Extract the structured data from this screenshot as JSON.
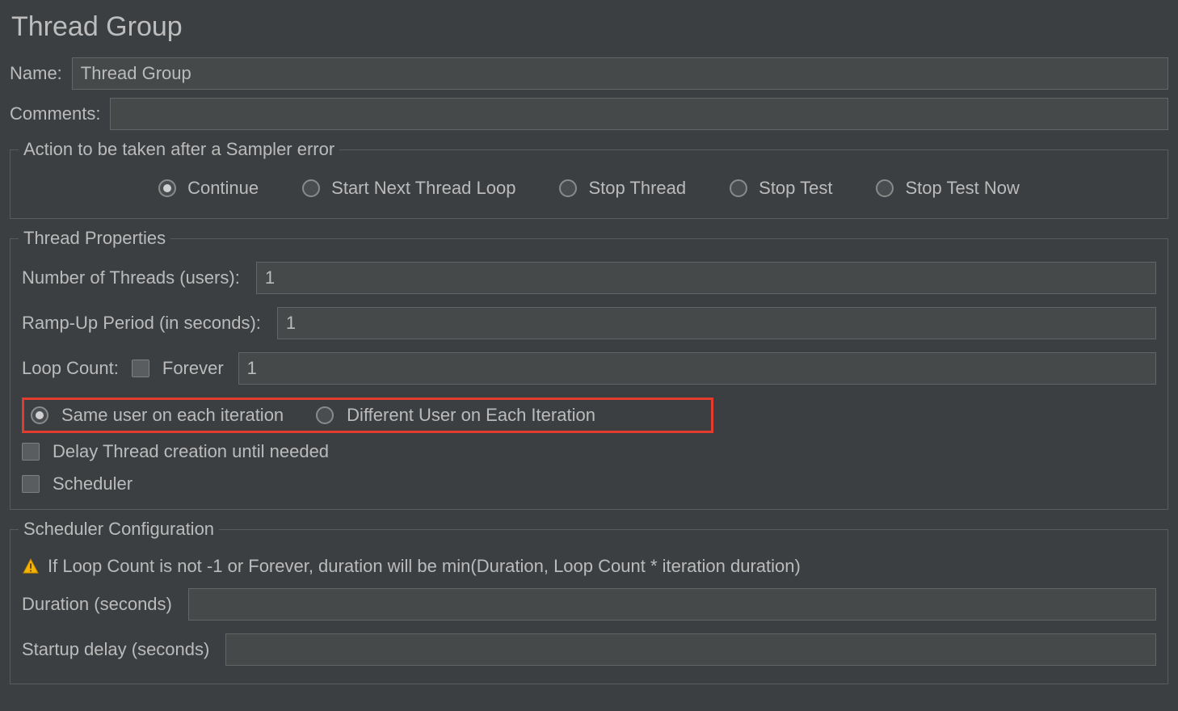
{
  "title": "Thread Group",
  "name": {
    "label": "Name:",
    "value": "Thread Group"
  },
  "comments": {
    "label": "Comments:",
    "value": ""
  },
  "sampler_error": {
    "legend": "Action to be taken after a Sampler error",
    "options": {
      "continue": "Continue",
      "start_next": "Start Next Thread Loop",
      "stop_thread": "Stop Thread",
      "stop_test": "Stop Test",
      "stop_test_now": "Stop Test Now"
    },
    "selected": "continue"
  },
  "thread_properties": {
    "legend": "Thread Properties",
    "num_threads": {
      "label": "Number of Threads (users):",
      "value": "1"
    },
    "ramp_up": {
      "label": "Ramp-Up Period (in seconds):",
      "value": "1"
    },
    "loop_count": {
      "label": "Loop Count:",
      "forever_label": "Forever",
      "value": "1"
    },
    "iteration": {
      "same": "Same user on each iteration",
      "different": "Different User on Each Iteration",
      "selected": "same"
    },
    "delay_creation": {
      "label": "Delay Thread creation until needed",
      "checked": false
    },
    "scheduler": {
      "label": "Scheduler",
      "checked": false
    }
  },
  "scheduler_config": {
    "legend": "Scheduler Configuration",
    "warning": "If Loop Count is not -1 or Forever, duration will be min(Duration, Loop Count * iteration duration)",
    "duration": {
      "label": "Duration (seconds)",
      "value": ""
    },
    "startup_delay": {
      "label": "Startup delay (seconds)",
      "value": ""
    }
  }
}
